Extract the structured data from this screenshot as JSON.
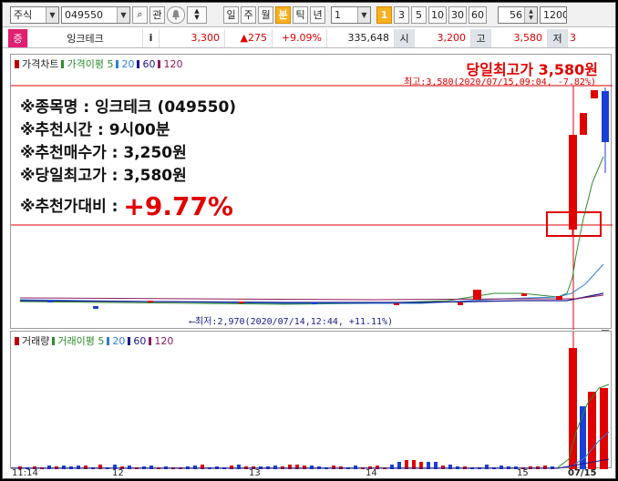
{
  "toolbar": {
    "market": "주식",
    "code": "049550",
    "search_glyph": "⌕",
    "rel_label": "관",
    "periods": [
      "일",
      "주",
      "월",
      "분",
      "틱",
      "년"
    ],
    "active_period": "분",
    "interval_value": "1",
    "intervals": [
      "1",
      "3",
      "5",
      "10",
      "30",
      "60"
    ],
    "active_interval": "1",
    "count_value": "56",
    "bar_count": "1200"
  },
  "quote": {
    "badge": "증",
    "name": "잉크테크",
    "info_label": "i",
    "price": "3,300",
    "change": "▲275",
    "change_pct": "+9.09%",
    "volume": "335,648",
    "open_label": "시",
    "open": "3,200",
    "high_label": "고",
    "high": "3,580",
    "low_label": "저",
    "low": "3"
  },
  "price_pane": {
    "legend": [
      {
        "label": "가격차트",
        "color": "#c00000"
      },
      {
        "label": "가격이평 5",
        "color": "#2e8b2e"
      },
      {
        "label": "20",
        "color": "#2f7fd6"
      },
      {
        "label": "60",
        "color": "#1a1a8c"
      },
      {
        "label": "120",
        "color": "#8b1a5a"
      }
    ],
    "high_note": "당일최고가 3,580원",
    "max_label": "최고:3,580(2020/07/15,09:04, -7.82%)",
    "min_label": "⟵최저:2,970(2020/07/14,12:44, +11.11%)"
  },
  "overlay": {
    "line1": "※종목명 : 잉크테크 (049550)",
    "line2": "※추천시간 : 9시00분",
    "line3": "※추천매수가 : 3,250원",
    "line4": "※당일최고가 : 3,580원",
    "line5_label": "※추천가대비 : ",
    "line5_value": "+9.77%"
  },
  "volume_pane": {
    "legend": [
      {
        "label": "거래량",
        "color": "#c00000"
      },
      {
        "label": "거래이평 5",
        "color": "#2e8b2e"
      },
      {
        "label": "20",
        "color": "#2f7fd6"
      },
      {
        "label": "60",
        "color": "#1a1a8c"
      },
      {
        "label": "120",
        "color": "#8b1a5a"
      }
    ]
  },
  "x_axis": {
    "labels": [
      "11:14",
      "12",
      "13",
      "14",
      "15",
      "07/15"
    ]
  },
  "colors": {
    "up": "#e00000",
    "down": "#1a3fd6",
    "accent": "#f7b01e"
  }
}
